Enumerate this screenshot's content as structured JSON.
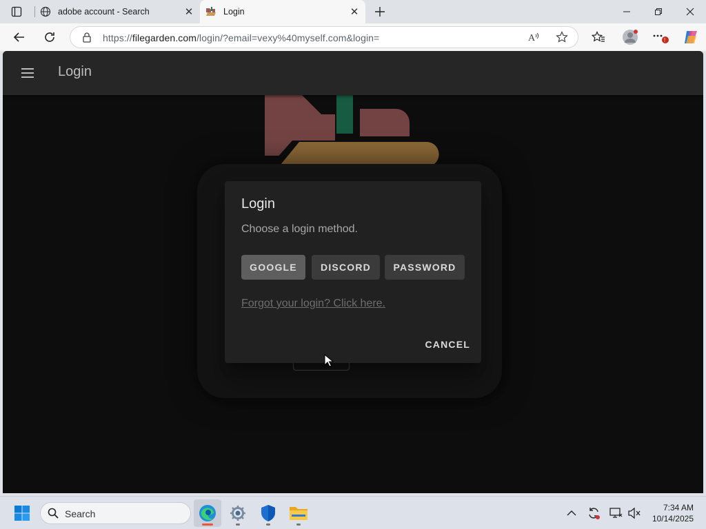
{
  "browser": {
    "tabs": [
      {
        "title": "adobe account - Search",
        "active": false,
        "favicon": "globe-icon"
      },
      {
        "title": "Login",
        "active": true,
        "favicon": "filegarden-icon"
      }
    ],
    "address": {
      "prefix": "https://",
      "host": "filegarden.com",
      "path": "/login/?email=vexy%40myself.com&login="
    }
  },
  "page": {
    "app_title": "Login",
    "dialog": {
      "title": "Login",
      "subtitle": "Choose a login method.",
      "methods": [
        "GOOGLE",
        "DISCORD",
        "PASSWORD"
      ],
      "forgot_link": "Forgot your login? Click here.",
      "cancel_label": "CANCEL"
    }
  },
  "taskbar": {
    "search_placeholder": "Search",
    "time": "7:34 AM",
    "date": "10/14/2025"
  },
  "colors": {
    "logo_red": "#9a5a5a",
    "logo_green": "#1f7a5a",
    "logo_gold": "#b98a4a",
    "background": "#121212",
    "dialog": "#212121"
  }
}
